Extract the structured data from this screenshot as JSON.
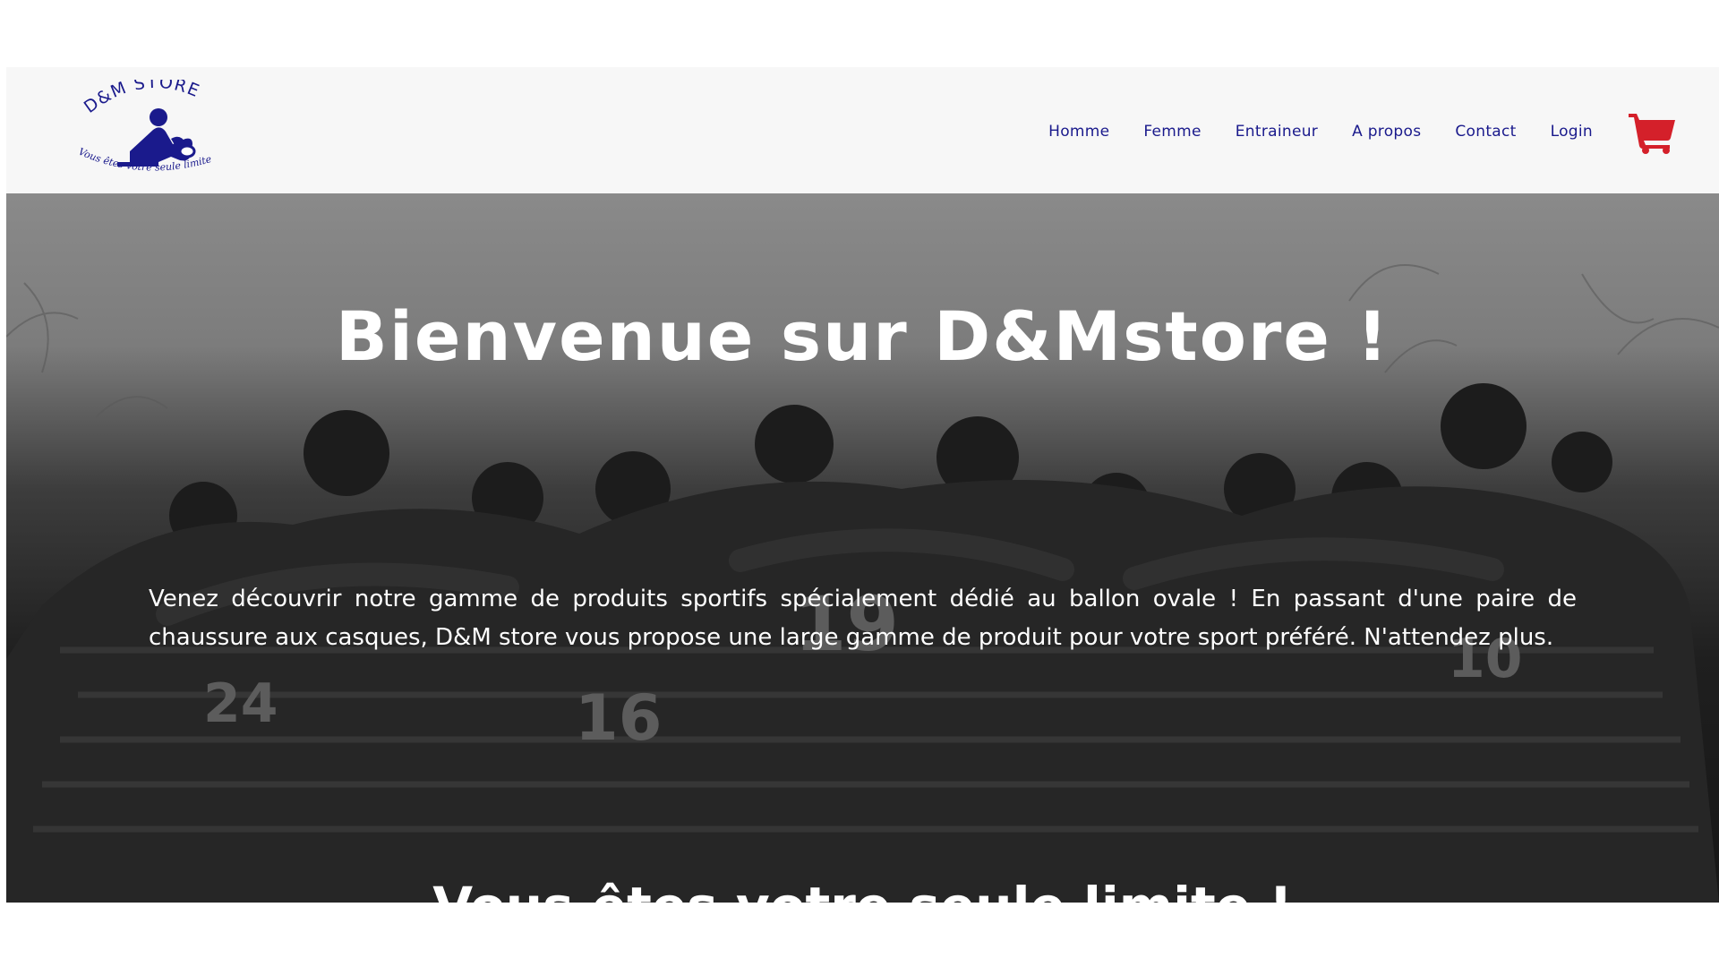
{
  "brand": {
    "logo_top_text": "D&M STORE",
    "logo_bottom_text": "Vous êtes votre seule limite",
    "logo_color": "#1a1a8c"
  },
  "nav": {
    "items": [
      "Homme",
      "Femme",
      "Entraineur",
      "A propos",
      "Contact",
      "Login"
    ],
    "cart_icon": "shopping-cart-icon",
    "cart_color": "#d4202a",
    "link_color": "#1a1a8c"
  },
  "hero": {
    "title": "Bienvenue sur D&Mstore !",
    "text": "Venez découvrir notre gamme de produits sportifs spécialement dédié au ballon ovale ! En passant d'une paire de chaussure aux casques, D&M store vous propose une large gamme de produit pour votre sport préféré. N'attendez plus.",
    "subtitle": "Vous êtes votre seule limite !",
    "background_image": "rugby-team-huddle-photo"
  }
}
